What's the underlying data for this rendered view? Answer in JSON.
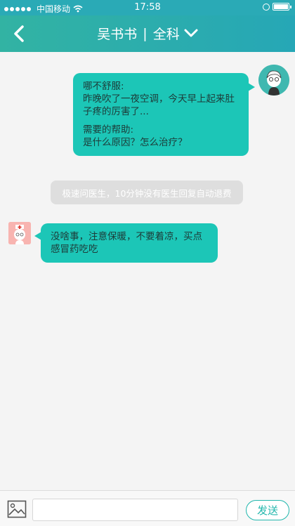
{
  "status_bar": {
    "carrier": "中国移动",
    "time": "17:58"
  },
  "nav": {
    "doctor": "吴书书",
    "separator": "|",
    "department": "全科"
  },
  "messages": {
    "user": {
      "q1_label": "哪不舒服:",
      "q1_text": "昨晚吹了一夜空调，今天早上起来肚子疼的厉害了...",
      "q2_label": "需要的帮助:",
      "q2_text": "是什么原因？怎么治疗？"
    },
    "system_note": "极速问医生，10分钟没有医生回复自动退费",
    "doctor_reply": "没啥事，注意保暖，不要着凉，买点感冒药吃吃"
  },
  "input_bar": {
    "placeholder": "",
    "send_label": "发送"
  },
  "colors": {
    "header": "#2aaab6",
    "bubble": "#1cc6b7",
    "send_border": "#22b7ad"
  }
}
